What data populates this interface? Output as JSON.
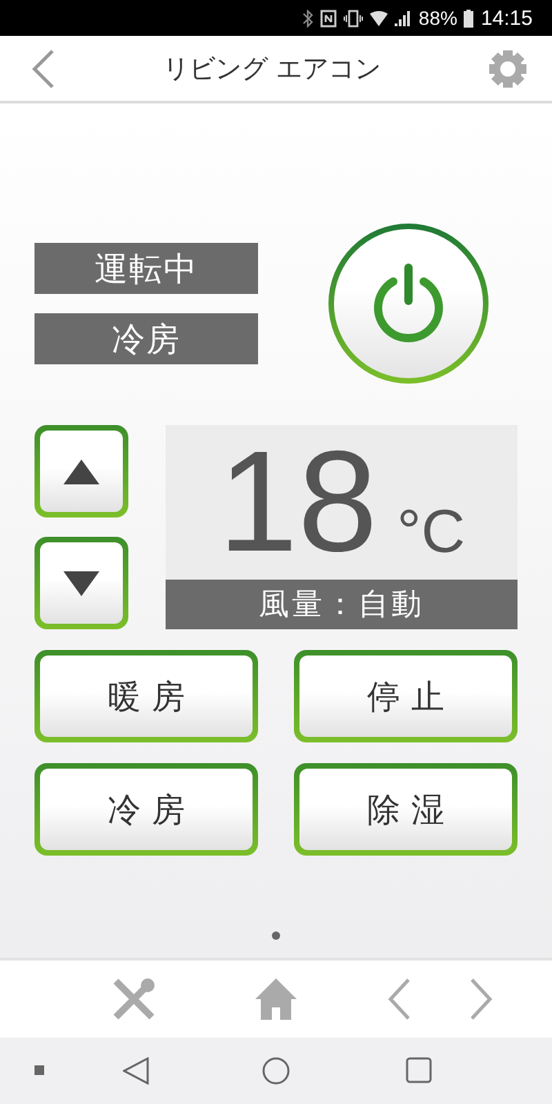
{
  "status_bar": {
    "battery": "88%",
    "time": "14:15"
  },
  "header": {
    "title": "リビング エアコン"
  },
  "status_labels": [
    "運転中",
    "冷房"
  ],
  "temperature": {
    "value": "18",
    "unit": "°C"
  },
  "fan_speed": "風量：自動",
  "mode_buttons": [
    "暖 房",
    "停 止",
    "冷 房",
    "除 湿"
  ],
  "page_dots": [
    {
      "selected": true
    }
  ]
}
